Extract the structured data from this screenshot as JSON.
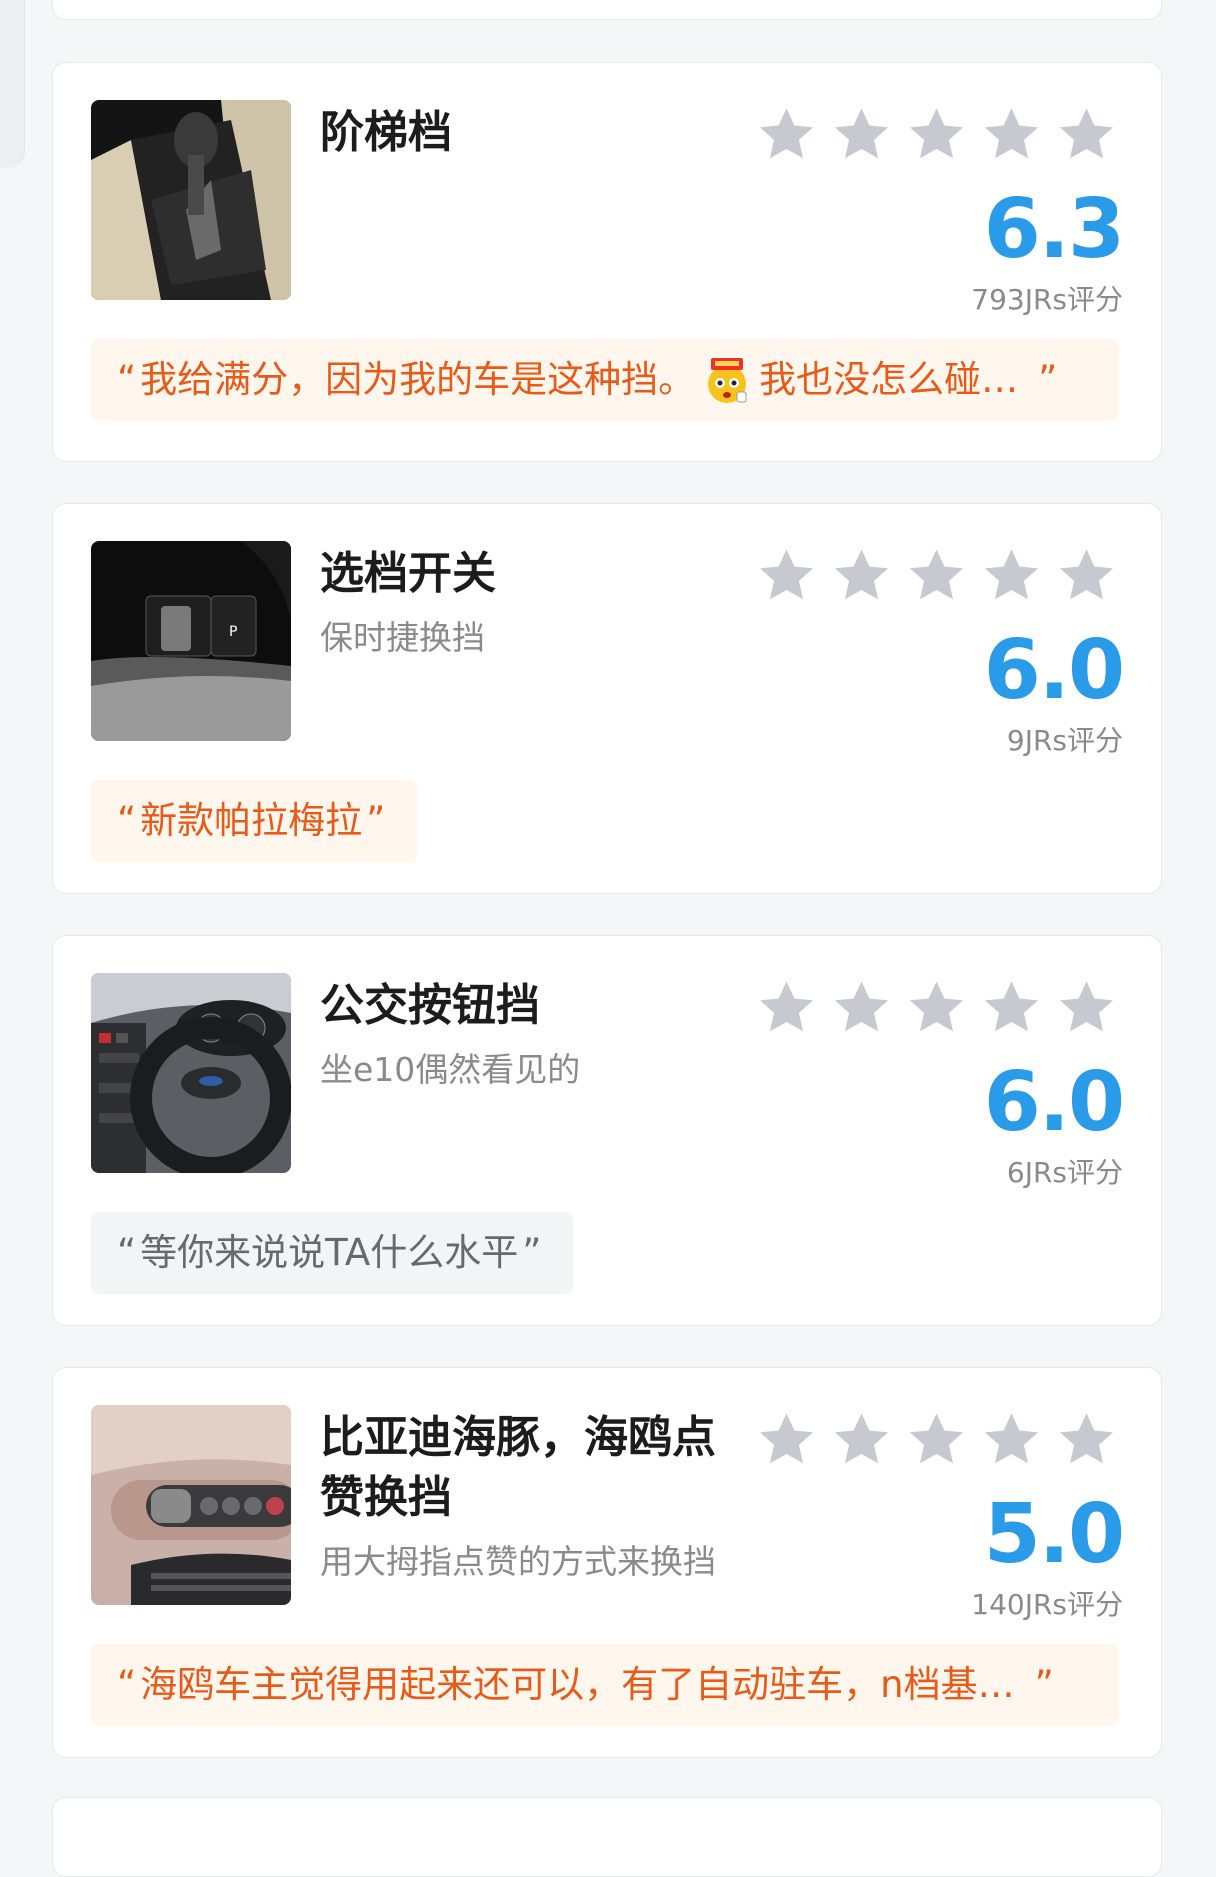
{
  "items": [
    {
      "title": "阶梯档",
      "subtitle": "",
      "score": "6.3",
      "votes": "793JRs评分",
      "stars_filled": 0,
      "comment": {
        "open_quote": "“",
        "text_before": "我给满分，因为我的车是这种挡。",
        "emoji": "jiayou-emoji-icon",
        "text_after": "我也没怎么碰…",
        "close_quote": "”",
        "style": "warm"
      }
    },
    {
      "title": "选档开关",
      "subtitle": "保时捷换挡",
      "score": "6.0",
      "votes": "9JRs评分",
      "stars_filled": 0,
      "comment": {
        "open_quote": "“",
        "text_before": "新款帕拉梅拉",
        "close_quote": "”",
        "style": "warm"
      }
    },
    {
      "title": "公交按钮挡",
      "subtitle": "坐e10偶然看见的",
      "score": "6.0",
      "votes": "6JRs评分",
      "stars_filled": 0,
      "comment": {
        "open_quote": "“",
        "text_before": "等你来说说TA什么水平",
        "close_quote": "”",
        "style": "grey"
      }
    },
    {
      "title": "比亚迪海豚，海鸥点赞换挡",
      "subtitle": "用大拇指点赞的方式来换挡",
      "score": "5.0",
      "votes": "140JRs评分",
      "stars_filled": 0,
      "comment": {
        "open_quote": "“",
        "text_before": "海鸥车主觉得用起来还可以，有了自动驻车，n档基…",
        "close_quote": "”",
        "style": "warm"
      }
    }
  ],
  "colors": {
    "score": "#2a9be8",
    "star_empty": "#c7c9d0",
    "comment_warm": "#e85a18",
    "comment_grey": "#666a70"
  }
}
